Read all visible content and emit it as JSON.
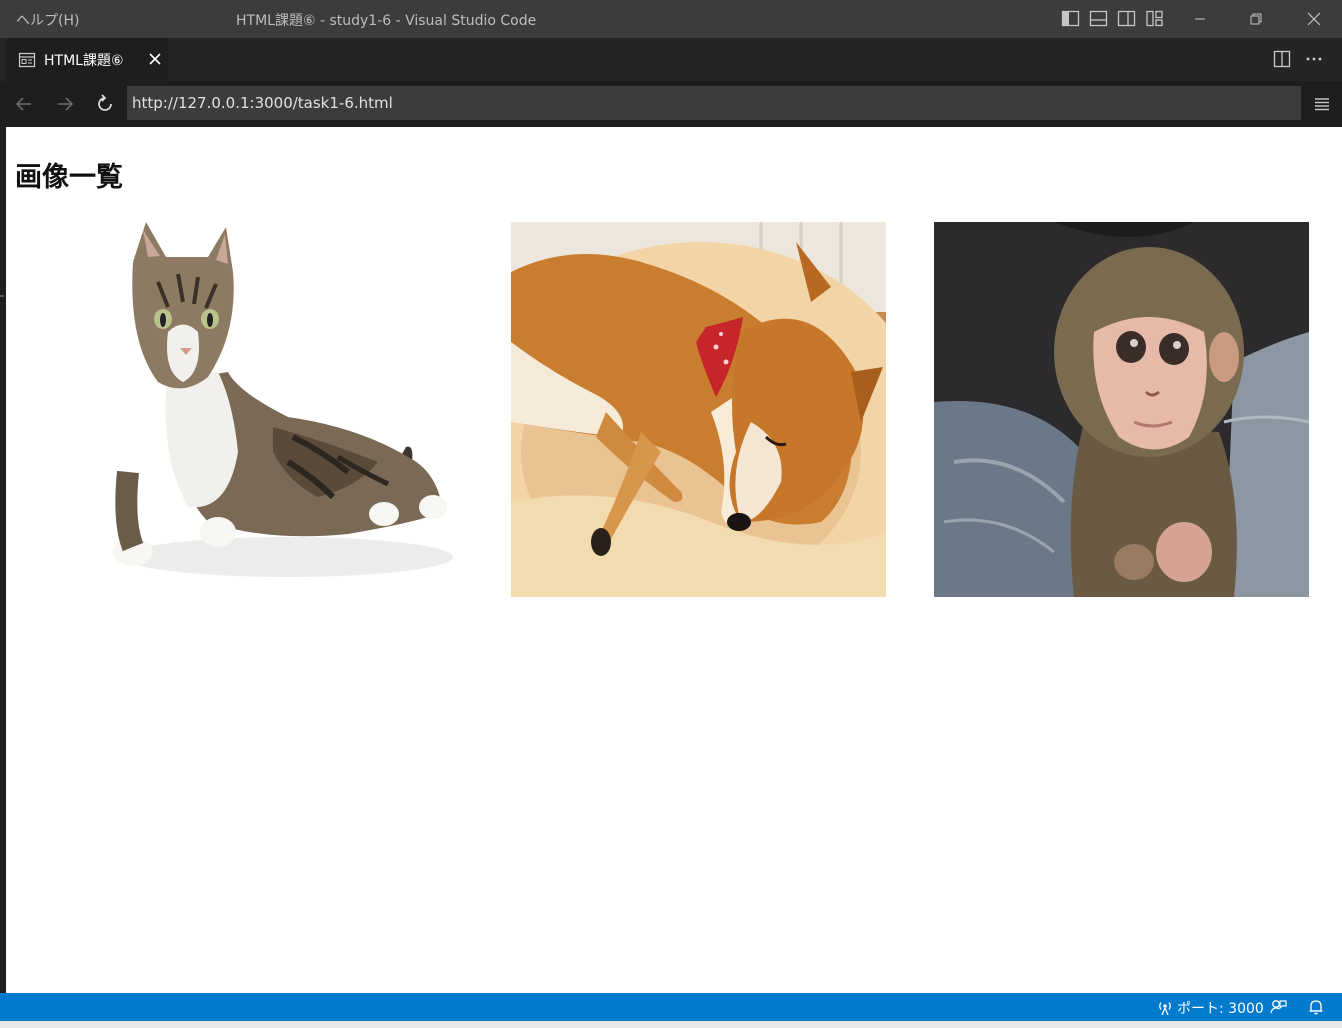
{
  "titlebar": {
    "menu": "ヘルプ(H)",
    "window_title": "HTML課題⑥ - study1-6 - Visual Studio Code",
    "layout_icons": [
      "toggle-primary-sidebar-icon",
      "toggle-panel-icon",
      "toggle-secondary-sidebar-icon",
      "customize-layout-icon"
    ]
  },
  "tab": {
    "label": "HTML課題⑥",
    "icon": "preview-icon"
  },
  "browser": {
    "url": "http://127.0.0.1:3000/task1-6.html"
  },
  "page": {
    "heading": "画像一覧",
    "images": [
      {
        "subject": "cat"
      },
      {
        "subject": "dog"
      },
      {
        "subject": "monkey"
      }
    ]
  },
  "statusbar": {
    "port_label": "ポート: 3000"
  },
  "colors": {
    "accent": "#007acc",
    "titlebar": "#3c3c3c",
    "editor": "#1e1e1e"
  }
}
